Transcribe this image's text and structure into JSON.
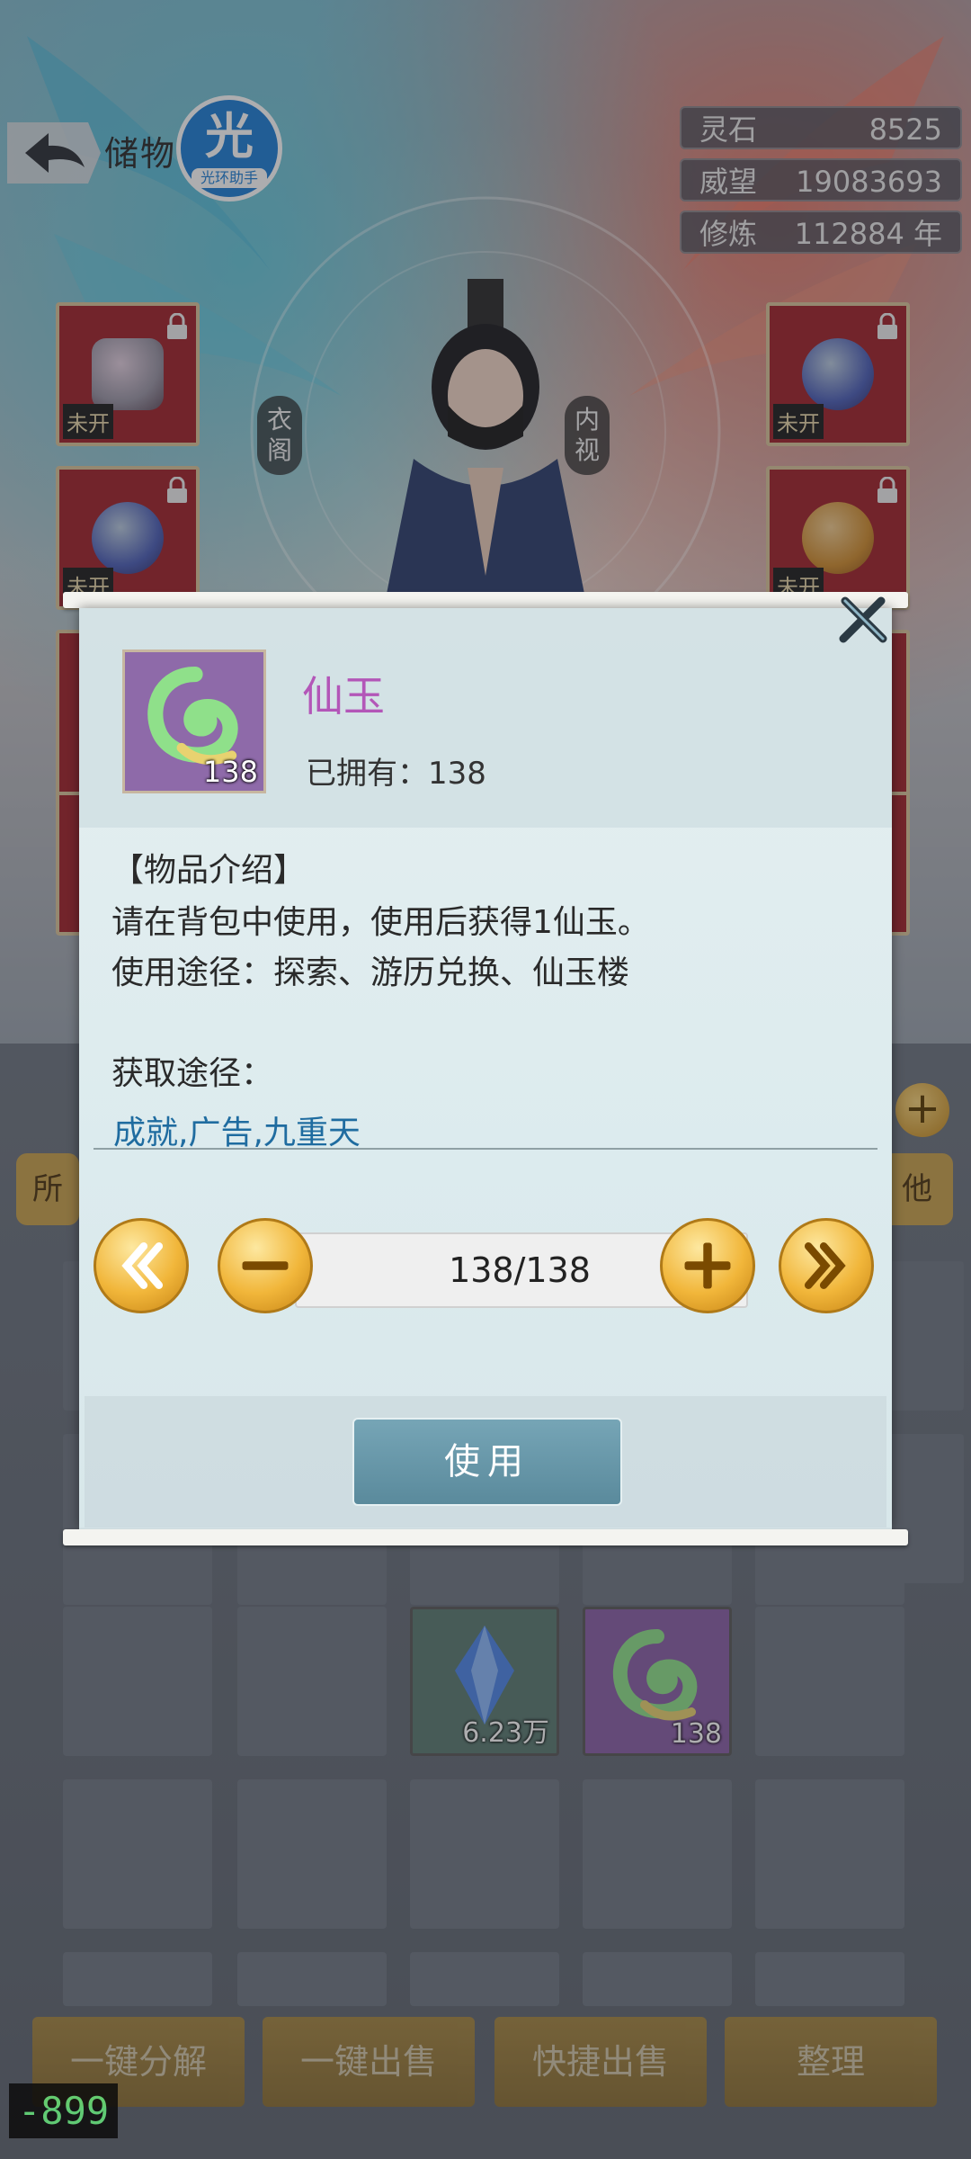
{
  "header": {
    "title": "储物",
    "badge": {
      "main": "光",
      "sub": "光环助手"
    }
  },
  "stats": [
    {
      "label": "灵石",
      "value": "8525"
    },
    {
      "label": "威望",
      "value": "19083693"
    },
    {
      "label": "修炼",
      "value": "112884 年"
    }
  ],
  "equip_tags": {
    "left1": "未开",
    "left2": "未开",
    "right1": "未开",
    "right2": "未开",
    "side_left": "衣阁",
    "side_right": "内视"
  },
  "filters": {
    "left": "所",
    "right": "他"
  },
  "inventory": {
    "crystal_count": "6.23万",
    "jade_count": "138"
  },
  "dialog": {
    "item_name": "仙玉",
    "icon_count": "138",
    "owned_label": "已拥有：",
    "owned_value": "138",
    "section_title": "【物品介绍】",
    "desc_line1": "请在背包中使用，使用后获得1仙玉。",
    "desc_line2": "使用途径：探索、游历兑换、仙玉楼",
    "source_label": "获取途径：",
    "source_links": "成就,广告,九重天",
    "quantity": "138/138",
    "use_label": "使用"
  },
  "bottom_buttons": [
    "一键分解",
    "一键出售",
    "快捷出售",
    "整理"
  ],
  "fps": "-899"
}
